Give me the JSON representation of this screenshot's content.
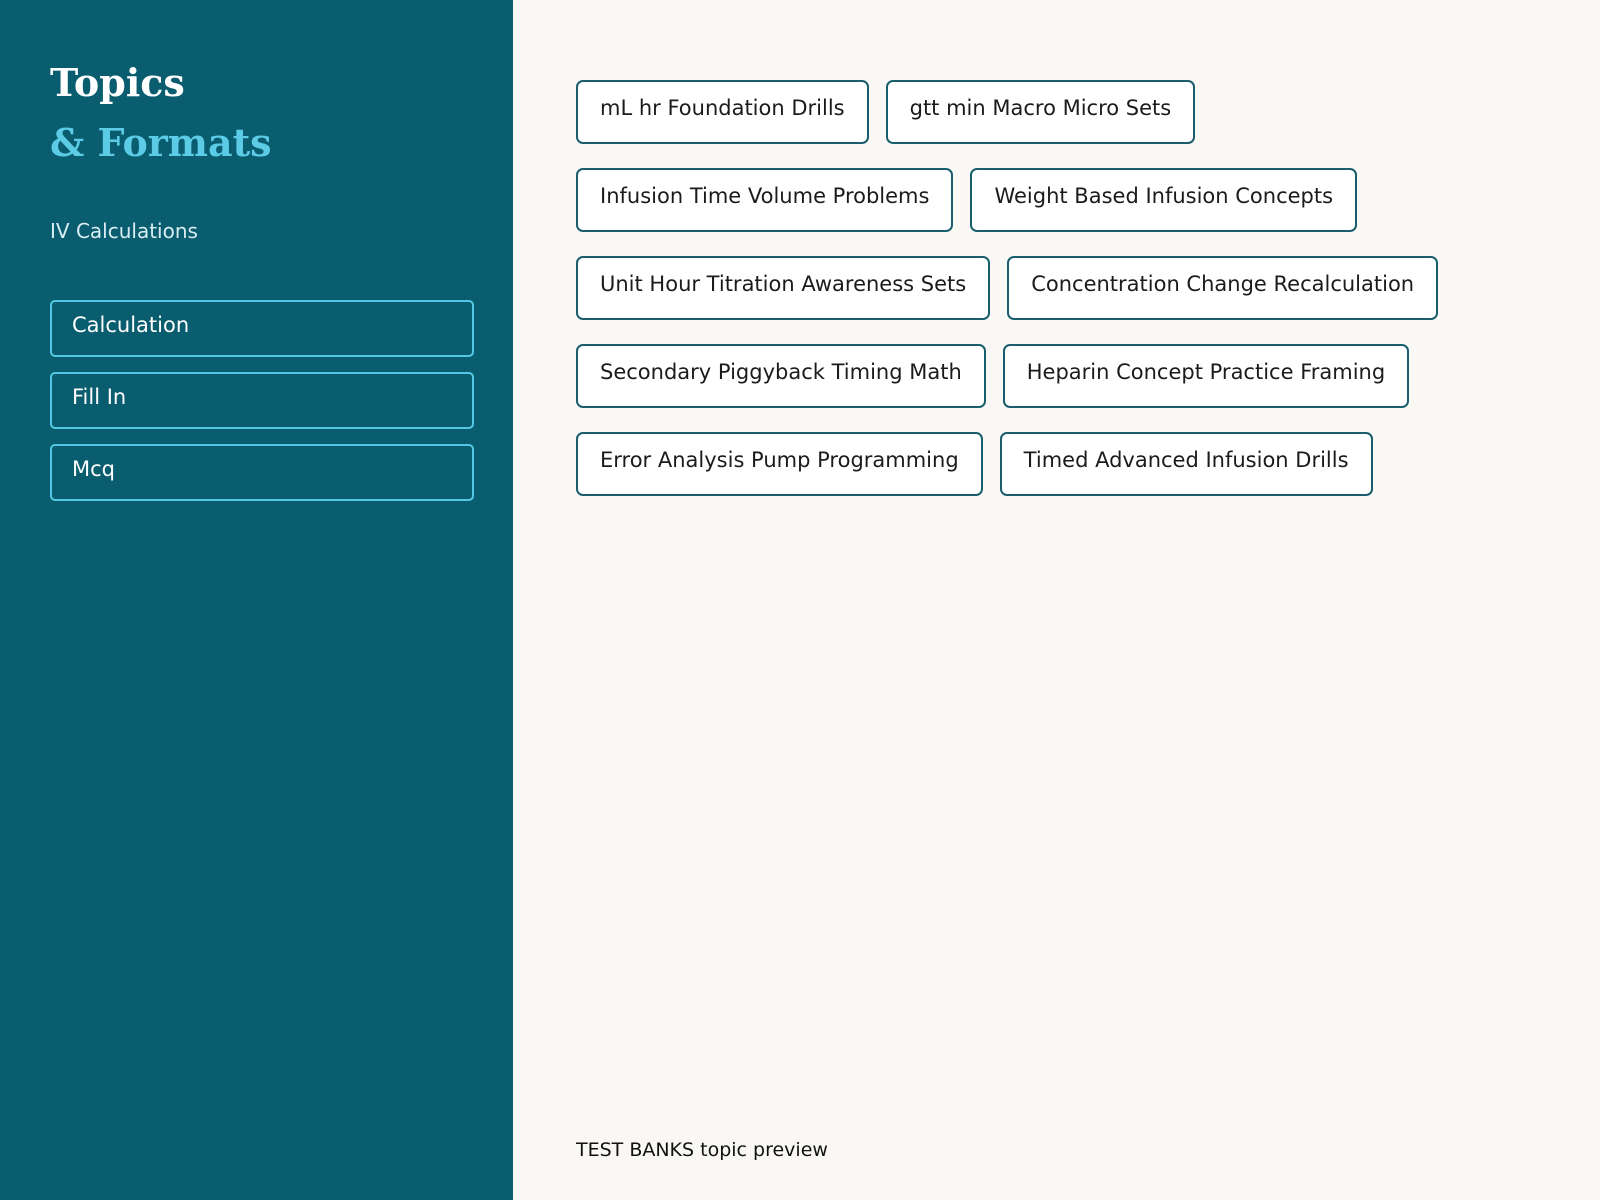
{
  "sidebar": {
    "title_line1": "Topics",
    "title_line2": "& Formats",
    "subtitle": "IV Calculations",
    "formats": [
      {
        "label": "Calculation"
      },
      {
        "label": "Fill In"
      },
      {
        "label": "Mcq"
      }
    ]
  },
  "main": {
    "topic_rows": [
      [
        "mL hr Foundation Drills",
        "gtt min Macro Micro Sets"
      ],
      [
        "Infusion Time Volume Problems",
        "Weight Based Infusion Concepts"
      ],
      [
        "Unit Hour Titration Awareness Sets",
        "Concentration Change Recalculation"
      ],
      [
        "Secondary Piggyback Timing Math",
        "Heparin Concept Practice Framing"
      ],
      [
        "Error Analysis Pump Programming",
        "Timed Advanced Infusion Drills"
      ]
    ]
  },
  "footer": {
    "text": "TEST BANKS topic preview"
  },
  "colors": {
    "sidebar_bg": "#0a5c6f",
    "accent": "#5ccbe6",
    "page_bg": "#faf8f5",
    "chip_border": "#1a5e6e"
  }
}
